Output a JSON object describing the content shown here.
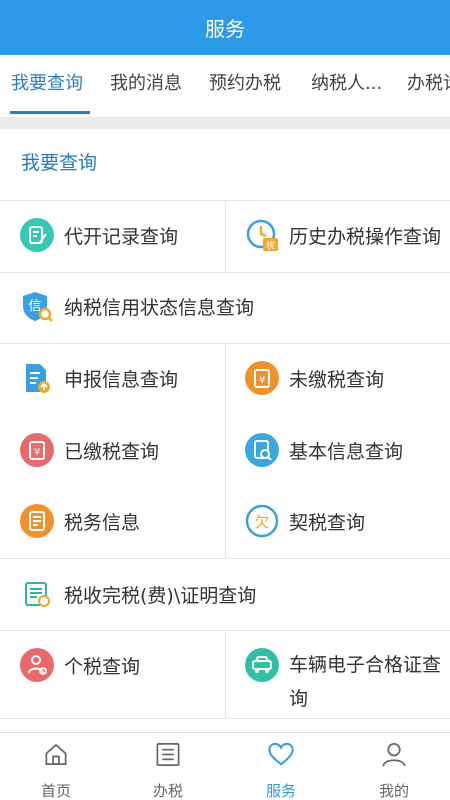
{
  "header": {
    "title": "服务"
  },
  "tabs": [
    {
      "label": "我要查询",
      "active": true
    },
    {
      "label": "我的消息"
    },
    {
      "label": "预约办税"
    },
    {
      "label": "纳税人..."
    },
    {
      "label": "办税论"
    }
  ],
  "section": {
    "title": "我要查询"
  },
  "items": [
    {
      "label": "代开记录查询",
      "icon": "invoice-record-icon",
      "color": "#37c8b4"
    },
    {
      "label": "历史办税操作查询",
      "icon": "history-clock-icon",
      "color": "#3aa0e0"
    },
    {
      "label": "纳税信用状态信息查询",
      "icon": "credit-shield-icon",
      "color": "#3aa0e0"
    },
    {
      "label": "申报信息查询",
      "icon": "declare-doc-icon",
      "color": "#3aa0e0"
    },
    {
      "label": "未缴税查询",
      "icon": "unpaid-tax-icon",
      "color": "#f0922b"
    },
    {
      "label": "已缴税查询",
      "icon": "paid-tax-icon",
      "color": "#ea6a6a"
    },
    {
      "label": "基本信息查询",
      "icon": "basic-info-icon",
      "color": "#3aa8e0"
    },
    {
      "label": "税务信息",
      "icon": "tax-info-icon",
      "color": "#f0922b"
    },
    {
      "label": "契税查询",
      "icon": "deed-tax-icon",
      "color": "#f0a92b"
    },
    {
      "label": "税收完税(费)\\证明查询",
      "icon": "tax-certificate-icon",
      "color": "#2fb59a"
    },
    {
      "label": "个税查询",
      "icon": "personal-tax-icon",
      "color": "#ea6a6a"
    },
    {
      "label": "车辆电子合格证查询",
      "icon": "vehicle-cert-icon",
      "color": "#2fc0a6"
    }
  ],
  "icon_glyphs": {
    "unpaid": "¥",
    "paid": "¥",
    "owe": "欠",
    "tax": "税",
    "credit": "信"
  },
  "bottom_nav": [
    {
      "label": "首页",
      "icon": "home-icon"
    },
    {
      "label": "办税",
      "icon": "list-icon"
    },
    {
      "label": "服务",
      "icon": "heart-icon",
      "active": true
    },
    {
      "label": "我的",
      "icon": "user-icon"
    }
  ],
  "colors": {
    "header": "#2d9ae8",
    "accent": "#2d7fc4",
    "divider": "#f1dff0"
  }
}
